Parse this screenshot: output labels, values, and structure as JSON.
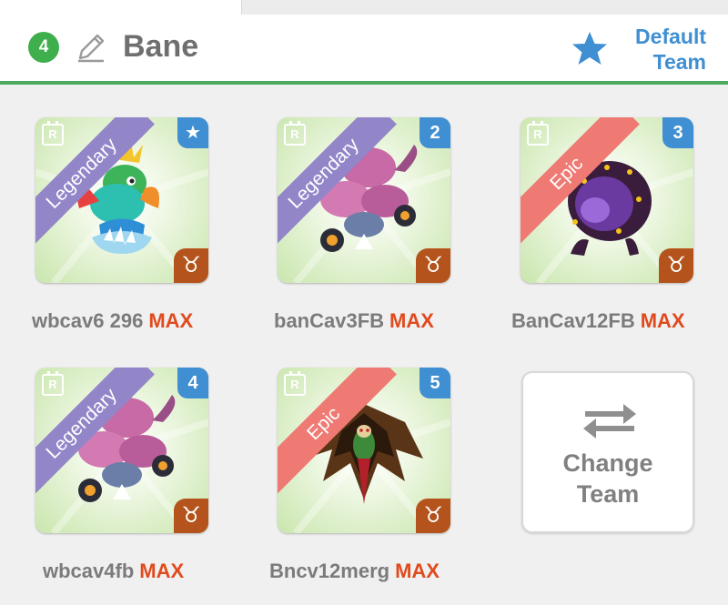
{
  "header": {
    "team_number": "4",
    "team_name": "Bane",
    "default_team_label_line1": "Default",
    "default_team_label_line2": "Team"
  },
  "monsters": [
    {
      "rarity": "Legendary",
      "slot": "★",
      "rank": "R",
      "name": "wbcav6 296",
      "level_tag": "MAX",
      "zodiac": "♉"
    },
    {
      "rarity": "Legendary",
      "slot": "2",
      "rank": "R",
      "name": "banCav3FB",
      "level_tag": "MAX",
      "zodiac": "♉"
    },
    {
      "rarity": "Epic",
      "slot": "3",
      "rank": "R",
      "name": "BanCav12FB",
      "level_tag": "MAX",
      "zodiac": "♉"
    },
    {
      "rarity": "Legendary",
      "slot": "4",
      "rank": "R",
      "name": "wbcav4fb",
      "level_tag": "MAX",
      "zodiac": "♉"
    },
    {
      "rarity": "Epic",
      "slot": "5",
      "rank": "R",
      "name": "Bncv12merg",
      "level_tag": "MAX",
      "zodiac": "♉"
    }
  ],
  "change_team": {
    "label_line1": "Change",
    "label_line2": "Team"
  },
  "colors": {
    "accent_green": "#4caa5c",
    "accent_blue": "#3f8fd2",
    "max_orange": "#e04a1e",
    "legendary": "#9286c9",
    "epic": "#ee7a73",
    "zodiac_brown": "#b4541c"
  },
  "icons": {
    "edit": "pencil-icon",
    "default": "star-icon",
    "swap": "swap-arrows-icon",
    "rank": "calendar-rank-icon",
    "zodiac": "taurus-icon"
  }
}
